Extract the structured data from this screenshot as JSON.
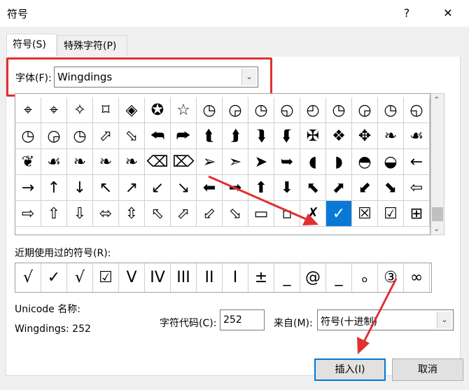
{
  "window": {
    "title": "符号",
    "help_label": "?",
    "close_label": "✕"
  },
  "tabs": [
    {
      "label": "符号(S)"
    },
    {
      "label": "特殊字符(P)"
    }
  ],
  "font": {
    "label": "字体(F):",
    "value": "Wingdings"
  },
  "symbol_grid": {
    "rows": [
      [
        "⌖",
        "⌖",
        "✧",
        "⌑",
        "◈",
        "✪",
        "☆",
        "◷",
        "◶",
        "◷",
        "◵",
        "◴",
        "◷",
        "◶",
        "◷",
        "◵"
      ],
      [
        "◷",
        "◶",
        "◷",
        "⬀",
        "⬂",
        "⮪",
        "⮫",
        "⮬",
        "⮭",
        "⮯",
        "⮮",
        "✠",
        "❖",
        "✥",
        "❧",
        "☙"
      ],
      [
        "❦",
        "☙",
        "❧",
        "❧",
        "❧",
        "⌫",
        "⌦",
        "➢",
        "➣",
        "➤",
        "➥",
        "◖",
        "◗",
        "◓",
        "◒",
        "←"
      ],
      [
        "→",
        "↑",
        "↓",
        "↖",
        "↗",
        "↙",
        "↘",
        "⬅",
        "➡",
        "⬆",
        "⬇",
        "⬉",
        "⬈",
        "⬋",
        "⬊",
        "⇦"
      ],
      [
        "⇨",
        "⇧",
        "⇩",
        "⬄",
        "⇳",
        "⬁",
        "⬀",
        "⬃",
        "⬂",
        "▭",
        "▫",
        "✗",
        "✓",
        "☒",
        "☑",
        "⊞"
      ]
    ],
    "selected_row": 4,
    "selected_col": 12
  },
  "recent": {
    "label": "近期使用过的符号(R):",
    "symbols": [
      "√",
      "✓",
      "√",
      "☑",
      "V",
      "IV",
      "III",
      "II",
      "I",
      "±",
      "_",
      "@",
      "_",
      "ₒ",
      "③",
      "∞"
    ]
  },
  "unicode_name": {
    "label": "Unicode 名称:",
    "value": "Wingdings: 252"
  },
  "char_code": {
    "label": "字符代码(C):",
    "value": "252"
  },
  "from": {
    "label": "来自(M):",
    "value": "符号(十进制)"
  },
  "buttons": {
    "insert": "插入(I)",
    "cancel": "取消"
  },
  "colors": {
    "highlight": "#e03030",
    "selection": "#0a78d7"
  }
}
